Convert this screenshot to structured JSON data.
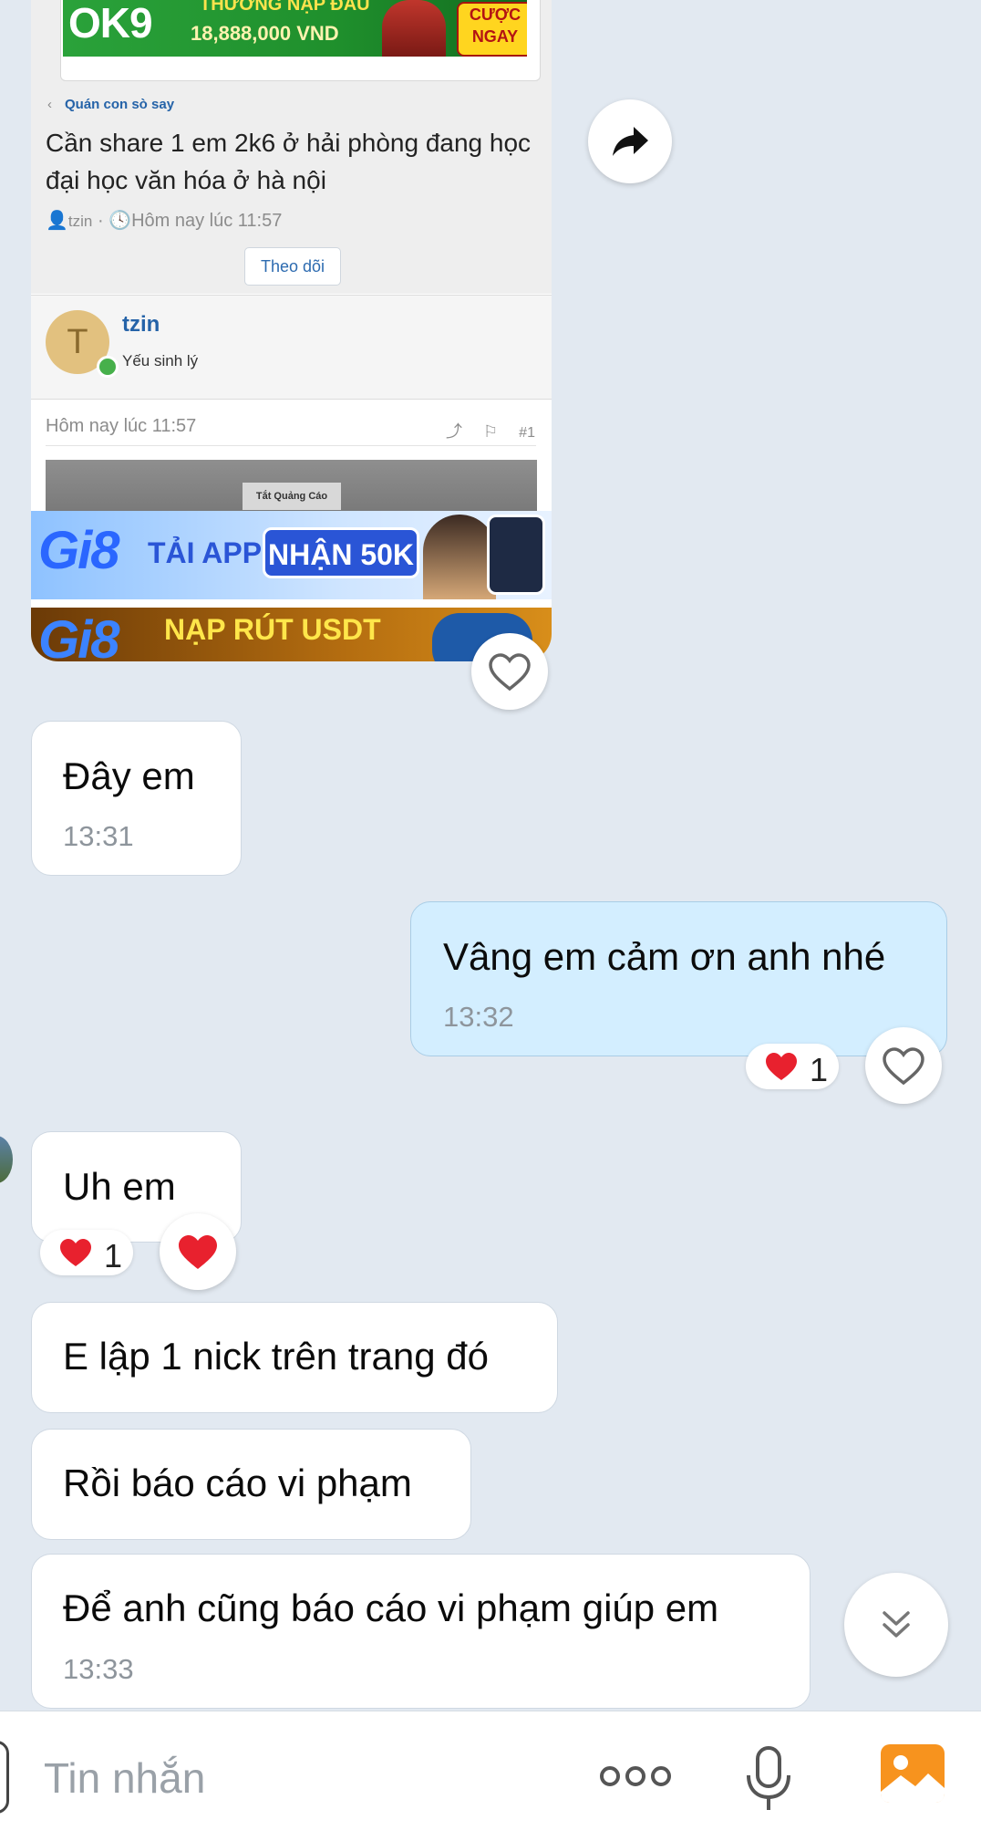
{
  "shared_post": {
    "ad_top": {
      "logo": "OK9",
      "line1": "THƯỞNG NẠP ĐẦU",
      "line2": "18,888,000 VND",
      "cta": "CƯỢC NGAY"
    },
    "breadcrumb": "Quán con sò say",
    "title": "Cần share 1 em 2k6 ở hải phòng đang học đại học văn hóa ở hà nội",
    "meta_author": "tzin",
    "meta_time": "Hôm nay lúc 11:57",
    "follow_label": "Theo dõi",
    "user": {
      "initial": "T",
      "name": "tzin",
      "role": "Yếu sinh lý"
    },
    "post_time": "Hôm nay lúc 11:57",
    "post_number": "#1",
    "ads_label": "Tắt Quảng Cáo",
    "ad_gi8_a": {
      "logo": "Gi8",
      "text": "TẢI APP",
      "pill": "NHẬN 50K"
    },
    "ad_gi8_b": {
      "logo": "Gi8",
      "text": "NẠP RÚT USDT"
    }
  },
  "messages": [
    {
      "text": "Đây em",
      "time": "13:31",
      "mine": false
    },
    {
      "text": "Vâng em cảm ơn anh nhé",
      "time": "13:32",
      "mine": true,
      "reaction": "1"
    },
    {
      "text": "Uh em",
      "mine": false,
      "reaction": "1"
    },
    {
      "text": "E lập 1 nick trên trang đó",
      "mine": false
    },
    {
      "text": "Rồi báo cáo vi phạm",
      "mine": false
    },
    {
      "text": "Để anh cũng báo cáo vi phạm giúp em",
      "time": "13:33",
      "mine": false
    }
  ],
  "composer": {
    "placeholder": "Tin nhắn"
  },
  "icons": {
    "share": "share-arrow-icon",
    "heart_outline": "heart-outline-icon",
    "heart_filled": "heart-filled-icon",
    "scroll_down": "double-chevron-down-icon",
    "more": "more-dots-icon",
    "mic": "microphone-icon",
    "image": "image-icon"
  },
  "colors": {
    "background": "#e2e9f1",
    "mine_bubble": "#d3eeff",
    "link": "#2563a8",
    "heart": "#e8212e",
    "image_icon": "#f7931e"
  }
}
